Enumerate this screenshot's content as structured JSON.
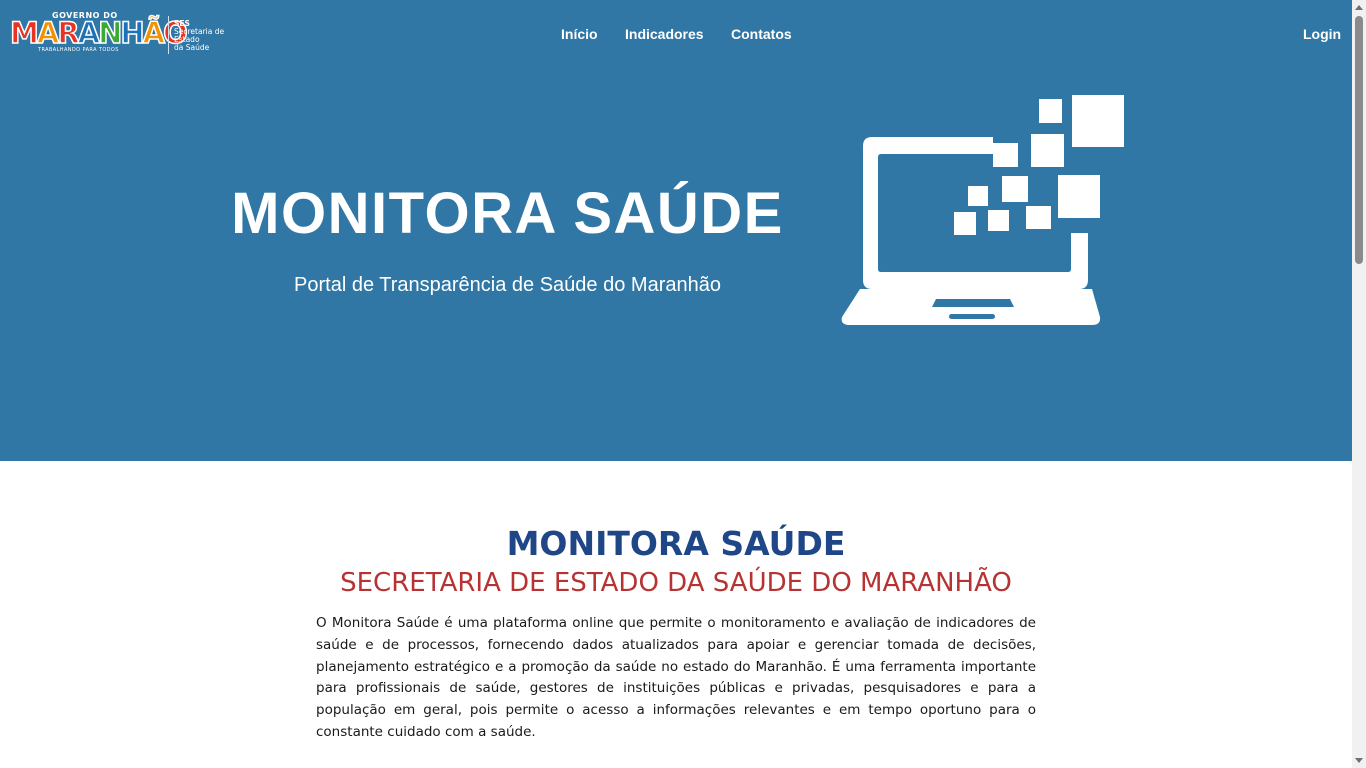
{
  "header": {
    "logo": {
      "top_text": "GOVERNO DO",
      "word_letters": [
        {
          "ch": "M",
          "color": "#e63323"
        },
        {
          "ch": "A",
          "color": "#f39200"
        },
        {
          "ch": "R",
          "color": "#e63323"
        },
        {
          "ch": "A",
          "color": "#1d71b8"
        },
        {
          "ch": "N",
          "color": "#3aaa35"
        },
        {
          "ch": "H",
          "color": "#1d71b8"
        },
        {
          "ch": "Ã",
          "color": "#f39200"
        },
        {
          "ch": "O",
          "color": "#e63323"
        }
      ],
      "bottom_text": "TRABALHANDO PARA TODOS",
      "ses_abbr": "SES",
      "ses_line1": "Secretaria de Estado",
      "ses_line2": "da Saúde"
    },
    "nav": {
      "inicio": "Início",
      "indicadores": "Indicadores",
      "contatos": "Contatos",
      "login": "Login"
    }
  },
  "hero": {
    "title": "MONITORA SAÚDE",
    "subtitle": "Portal de Transparência de Saúde do Maranhão",
    "background_color": "#3177a6",
    "art_icon": "laptop-data-icon"
  },
  "main": {
    "title": "MONITORA SAÚDE",
    "subtitle": "SECRETARIA DE ESTADO DA SAÚDE DO MARANHÃO",
    "paragraph": "O Monitora Saúde é uma plataforma online que permite o monitoramento e avaliação de indicadores de saúde e de processos, fornecendo dados atualizados para apoiar e gerenciar tomada de decisões, planejamento estratégico e a promoção da saúde no estado do Maranhão. É uma ferramenta importante para profissionais de saúde, gestores de instituições públicas e privadas, pesquisadores e para a população em geral, pois permite o acesso a informações relevantes e em tempo oportuno para o constante cuidado com a saúde.",
    "title_color": "#1f4788",
    "subtitle_color": "#b73333"
  }
}
